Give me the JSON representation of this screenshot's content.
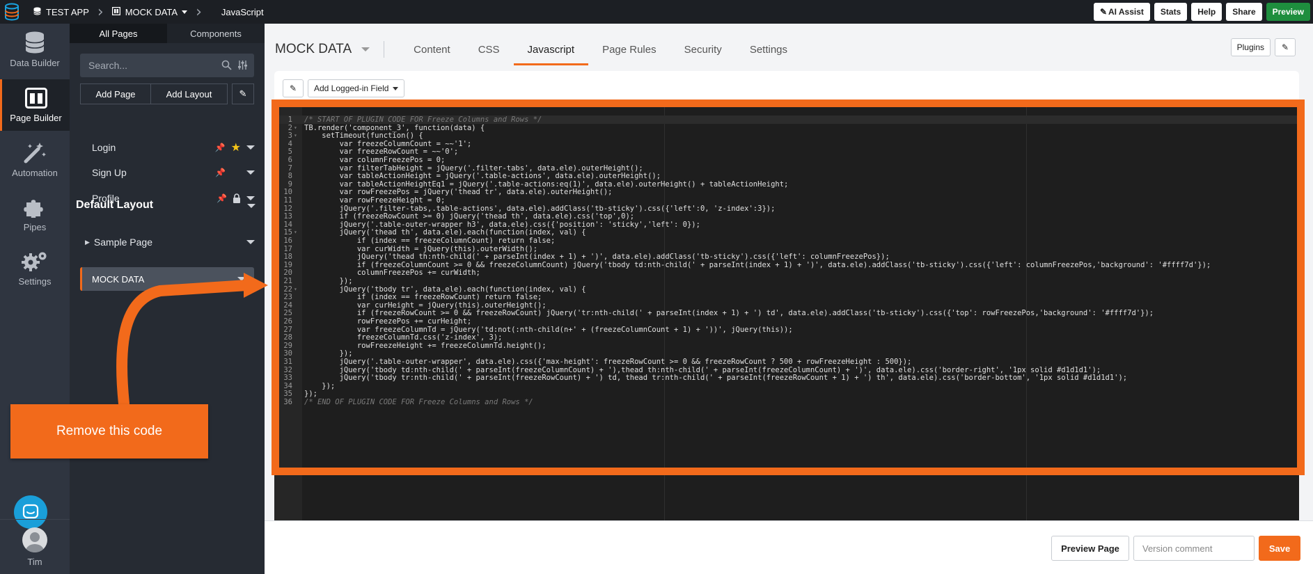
{
  "topbar": {
    "app_name": "TEST APP",
    "section": "MOCK DATA",
    "current": "JavaScript",
    "buttons": [
      "AI Assist",
      "Stats",
      "Help",
      "Share",
      "Preview"
    ]
  },
  "rail": {
    "items": [
      {
        "label": "Data Builder",
        "icon": "database-icon"
      },
      {
        "label": "Page Builder",
        "icon": "page-layout-icon",
        "active": true
      },
      {
        "label": "Automation",
        "icon": "magic-wand-icon"
      },
      {
        "label": "Pipes",
        "icon": "puzzle-icon"
      },
      {
        "label": "Settings",
        "icon": "gears-icon"
      }
    ],
    "user": "Tim"
  },
  "panel": {
    "tabs": [
      "All Pages",
      "Components"
    ],
    "search_placeholder": "Search...",
    "add_page": "Add Page",
    "add_layout": "Add Layout",
    "pages": [
      "Login",
      "Sign Up",
      "Profile"
    ],
    "layout_title": "Default Layout",
    "sample_page": "Sample Page",
    "selected_page": "MOCK DATA"
  },
  "main": {
    "title": "MOCK DATA",
    "tabs": [
      "Content",
      "CSS",
      "Javascript",
      "Page Rules",
      "Security",
      "Settings"
    ],
    "active_tab": "Javascript",
    "plugins": "Plugins",
    "add_field": "Add Logged-in Field"
  },
  "code_lines": [
    "/* START OF PLUGIN CODE FOR Freeze Columns and Rows */",
    "TB.render('component_3', function(data) {",
    "    setTimeout(function() {",
    "        var freezeColumnCount = ~~'1';",
    "        var freezeRowCount = ~~'0';",
    "        var columnFreezePos = 0;",
    "        var filterTabHeight = jQuery('.filter-tabs', data.ele).outerHeight();",
    "        var tableActionHeight = jQuery('.table-actions', data.ele).outerHeight();",
    "        var tableActionHeightEq1 = jQuery('.table-actions:eq(1)', data.ele).outerHeight() + tableActionHeight;",
    "        var rowFreezePos = jQuery('thead tr', data.ele).outerHeight();",
    "        var rowFreezeHeight = 0;",
    "        jQuery('.filter-tabs,.table-actions', data.ele).addClass('tb-sticky').css({'left':0, 'z-index':3});",
    "        if (freezeRowCount >= 0) jQuery('thead th', data.ele).css('top',0);",
    "        jQuery('.table-outer-wrapper h3', data.ele).css({'position': 'sticky','left': 0});",
    "        jQuery('thead th', data.ele).each(function(index, val) {",
    "            if (index == freezeColumnCount) return false;",
    "            var curWidth = jQuery(this).outerWidth();",
    "            jQuery('thead th:nth-child(' + parseInt(index + 1) + ')', data.ele).addClass('tb-sticky').css({'left': columnFreezePos});",
    "            if (freezeColumnCount >= 0 && freezeColumnCount) jQuery('tbody td:nth-child(' + parseInt(index + 1) + ')', data.ele).addClass('tb-sticky').css({'left': columnFreezePos,'background': '#ffff7d'});",
    "            columnFreezePos += curWidth;",
    "        });",
    "        jQuery('tbody tr', data.ele).each(function(index, val) {",
    "            if (index == freezeRowCount) return false;",
    "            var curHeight = jQuery(this).outerHeight();",
    "            if (freezeRowCount >= 0 && freezeRowCount) jQuery('tr:nth-child(' + parseInt(index + 1) + ') td', data.ele).addClass('tb-sticky').css({'top': rowFreezePos,'background': '#ffff7d'});",
    "            rowFreezePos += curHeight;",
    "            var freezeColumnTd = jQuery('td:not(:nth-child(n+' + (freezeColumnCount + 1) + '))', jQuery(this));",
    "            freezeColumnTd.css('z-index', 3);",
    "            rowFreezeHeight += freezeColumnTd.height();",
    "        });",
    "        jQuery('.table-outer-wrapper', data.ele).css({'max-height': freezeRowCount >= 0 && freezeRowCount ? 500 + rowFreezeHeight : 500});",
    "        jQuery('tbody td:nth-child(' + parseInt(freezeColumnCount) + '),thead th:nth-child(' + parseInt(freezeColumnCount) + ')', data.ele).css('border-right', '1px solid #d1d1d1');",
    "        jQuery('tbody tr:nth-child(' + parseInt(freezeRowCount) + ') td, thead tr:nth-child(' + parseInt(freezeRowCount + 1) + ') th', data.ele).css('border-bottom', '1px solid #d1d1d1');",
    "    });",
    "});",
    "/* END OF PLUGIN CODE FOR Freeze Columns and Rows */"
  ],
  "footer": {
    "preview_page": "Preview Page",
    "version_placeholder": "Version comment",
    "save": "Save"
  },
  "annotation": {
    "text": "Remove this code"
  },
  "colors": {
    "accent": "#f26a1b",
    "preview_green": "#1e8e3e",
    "chat_blue": "#1a9fd9"
  }
}
